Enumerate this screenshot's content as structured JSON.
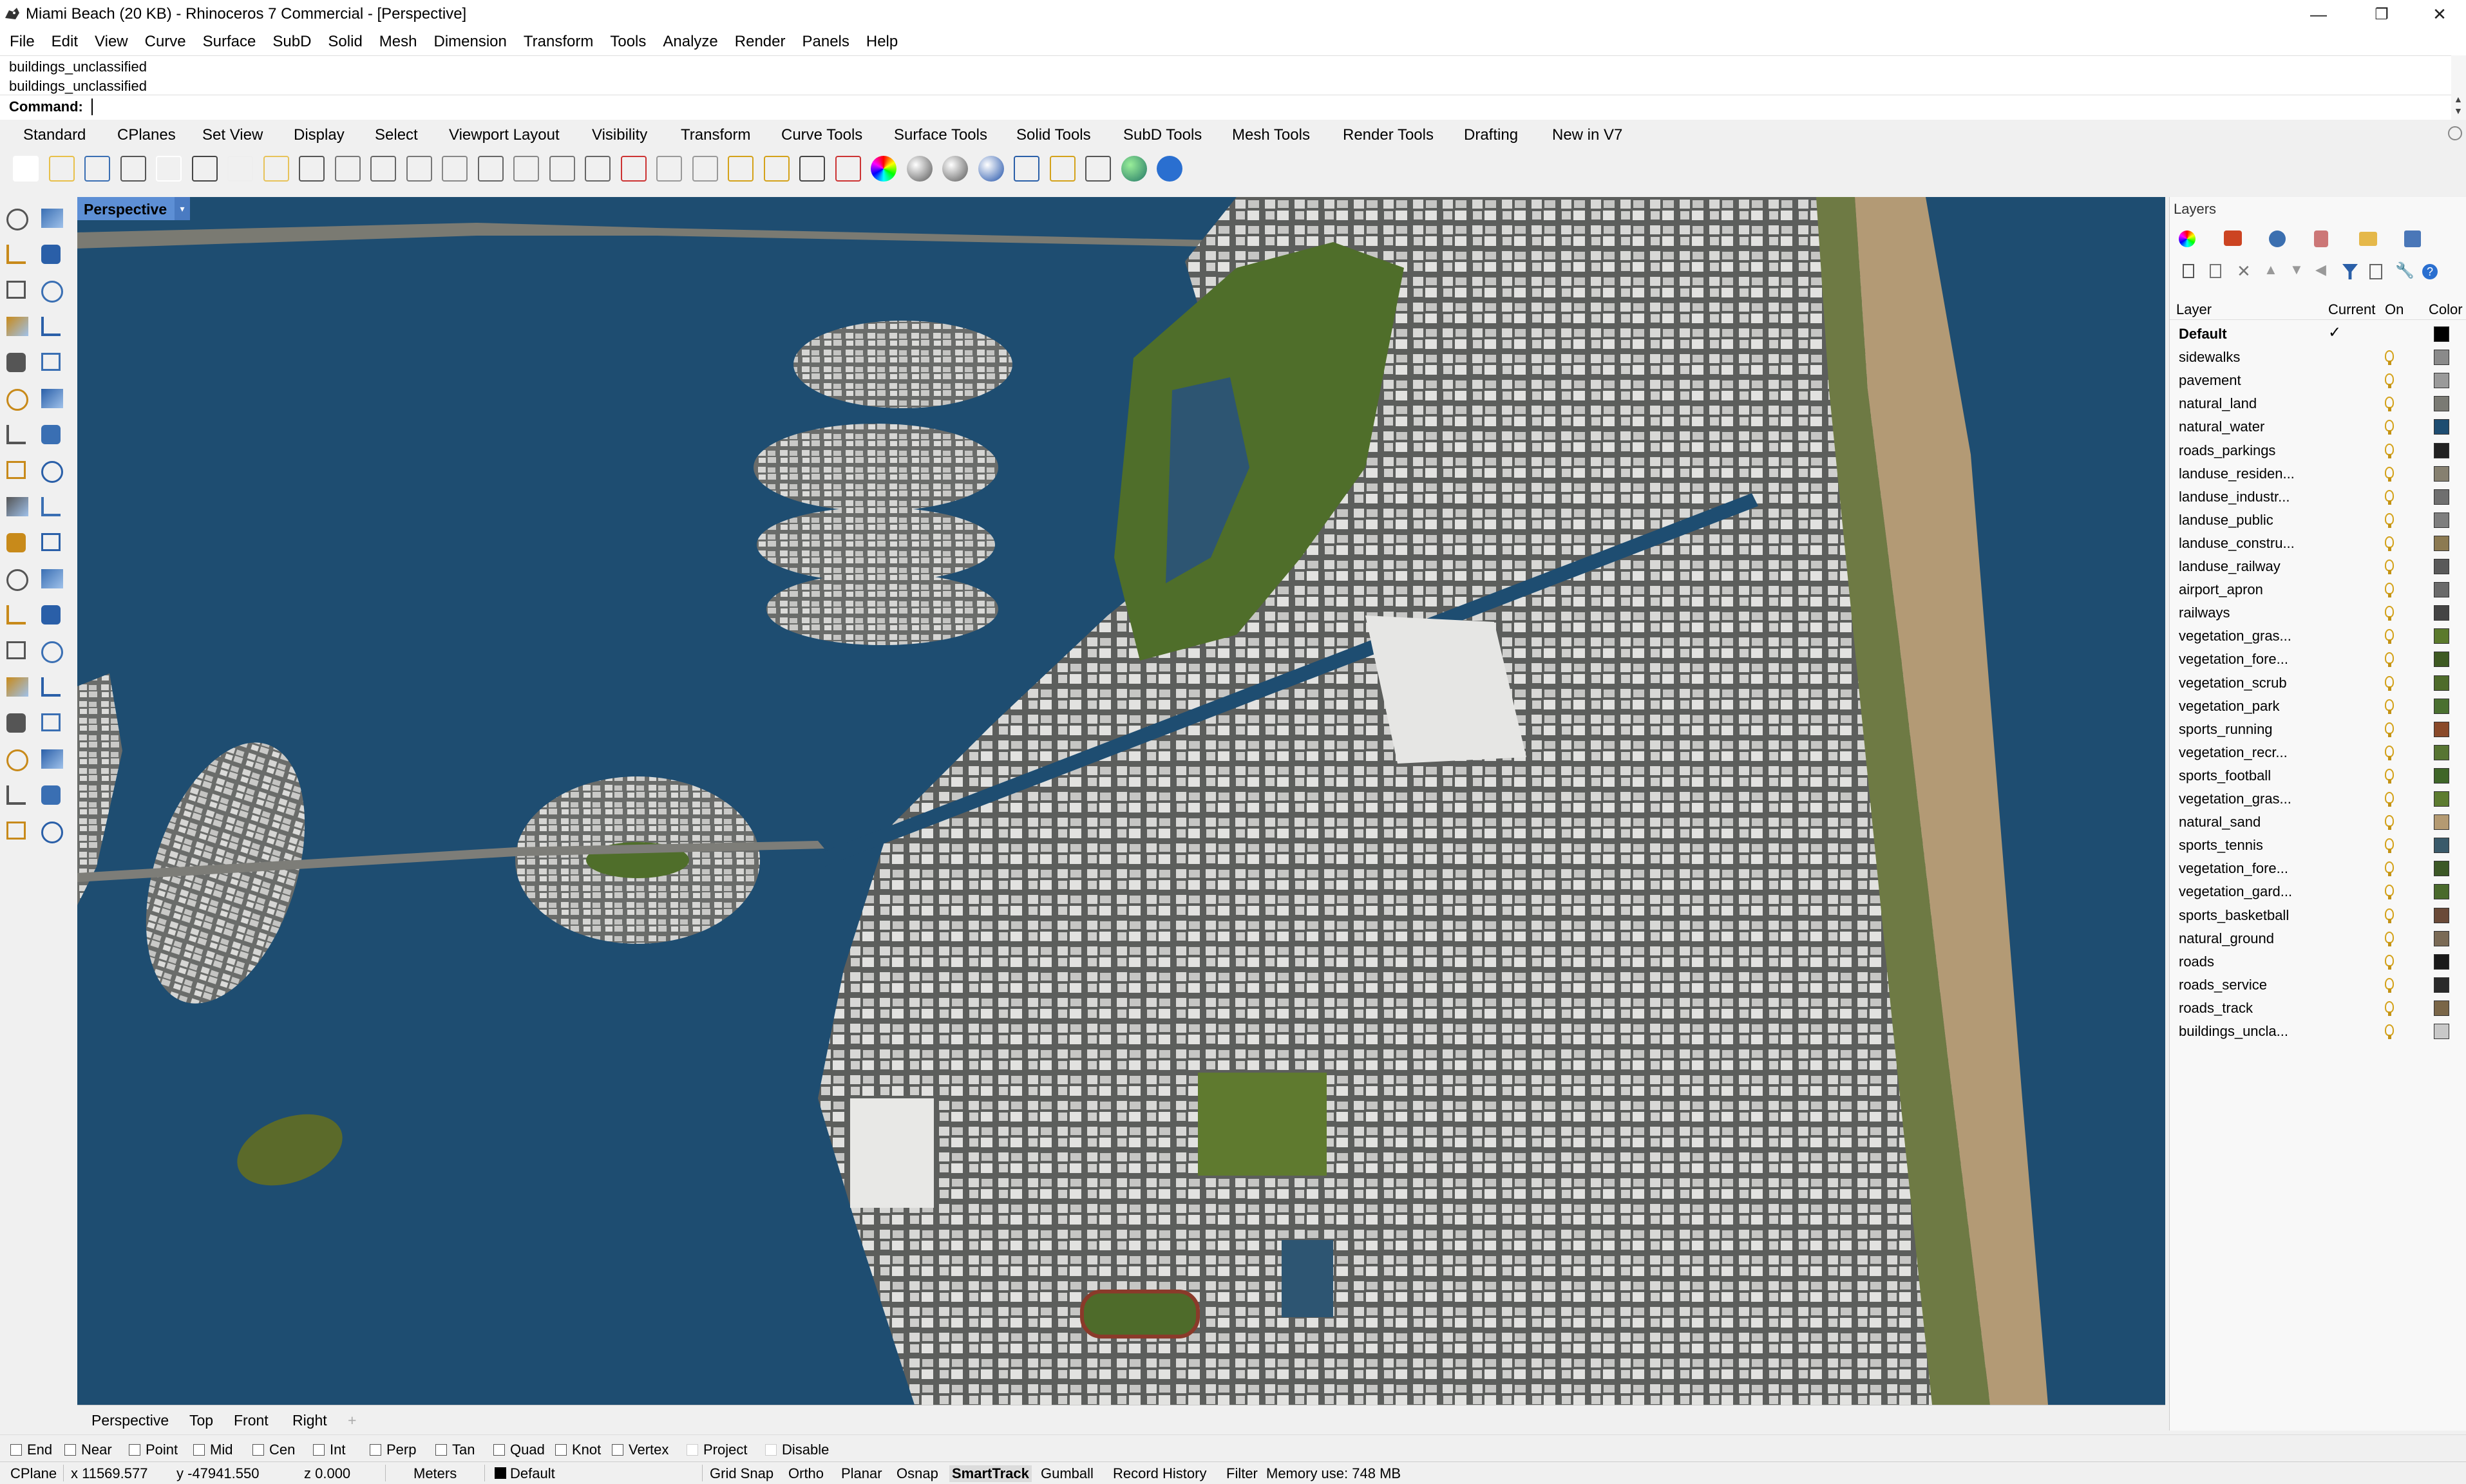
{
  "window": {
    "title": "Miami Beach (20 KB) - Rhinoceros 7 Commercial - [Perspective]",
    "min_glyph": "—",
    "max_glyph": "❐",
    "close_glyph": "✕"
  },
  "menu": [
    "File",
    "Edit",
    "View",
    "Curve",
    "Surface",
    "SubD",
    "Solid",
    "Mesh",
    "Dimension",
    "Transform",
    "Tools",
    "Analyze",
    "Render",
    "Panels",
    "Help"
  ],
  "command": {
    "history": [
      "buildings_unclassified",
      "buildings_unclassified"
    ],
    "prompt": "Command:",
    "value": ""
  },
  "tabs": [
    "Standard",
    "CPlanes",
    "Set View",
    "Display",
    "Select",
    "Viewport Layout",
    "Visibility",
    "Transform",
    "Curve Tools",
    "Surface Tools",
    "Solid Tools",
    "SubD Tools",
    "Mesh Tools",
    "Render Tools",
    "Drafting",
    "New in V7"
  ],
  "toolbar_icons": [
    "new-icon",
    "open-icon",
    "save-icon",
    "print-icon",
    "import-icon",
    "cut-icon",
    "copy-icon",
    "paste-icon",
    "undo-icon",
    "pan-icon",
    "rotate-view-icon",
    "zoom-icon",
    "zoom-window-icon",
    "zoom-extents-icon",
    "zoom-selected-icon",
    "zoom-all-icon",
    "four-views-icon",
    "car-icon",
    "grid-icon",
    "dimension-icon",
    "snap-icon",
    "light-icon",
    "lock-icon",
    "layer-icon",
    "color-wheel-icon",
    "shaded-sphere-icon",
    "render-sphere-icon",
    "rendered-icon",
    "spotlight-icon",
    "options-gear-icon",
    "scale-icon",
    "globe-icon",
    "help-icon"
  ],
  "left_tools": [
    "select-icon",
    "point-icon",
    "polyline-icon",
    "curve-icon",
    "circle-icon",
    "ellipse-icon",
    "arc-icon",
    "rectangle-icon",
    "polygon-icon",
    "free-curve-icon",
    "surface-icon",
    "extrude-surface-icon",
    "box-icon",
    "sphere-icon",
    "cylinder-icon",
    "mesh-icon",
    "loft-icon",
    "flame-icon",
    "trim-icon",
    "split-icon",
    "boolean-icon",
    "fillet-icon",
    "fillet-edge-icon",
    "blend-icon",
    "text-icon",
    "scale-icon",
    "array-icon",
    "move-icon",
    "solid-icon",
    "shelf-icon",
    "grid-array-icon",
    "gumball-icon",
    "edit-icon",
    "check-icon",
    "render-preview-icon",
    "paint-icon"
  ],
  "viewport": {
    "label": "Perspective",
    "dropdown_glyph": "▾"
  },
  "viewport_tabs": [
    "Perspective",
    "Top",
    "Front",
    "Right",
    "+"
  ],
  "panel": {
    "title": "Layers",
    "columns": {
      "layer": "Layer",
      "current": "Current",
      "on": "On",
      "color": "Color"
    },
    "current_mark": "✓",
    "layers": [
      {
        "name": "Default",
        "color": "#000000"
      },
      {
        "name": "sidewalks",
        "color": "#8a8a8a"
      },
      {
        "name": "pavement",
        "color": "#9a9a9a"
      },
      {
        "name": "natural_land",
        "color": "#7a7a74"
      },
      {
        "name": "natural_water",
        "color": "#1e4d71"
      },
      {
        "name": "roads_parkings",
        "color": "#222222"
      },
      {
        "name": "landuse_residen...",
        "color": "#868070"
      },
      {
        "name": "landuse_industr...",
        "color": "#6f6f6f"
      },
      {
        "name": "landuse_public",
        "color": "#7e7e7e"
      },
      {
        "name": "landuse_constru...",
        "color": "#8c7a52"
      },
      {
        "name": "landuse_railway",
        "color": "#5a5a5a"
      },
      {
        "name": "airport_apron",
        "color": "#6a6a6a"
      },
      {
        "name": "railways",
        "color": "#444444"
      },
      {
        "name": "vegetation_gras...",
        "color": "#5b7a2c"
      },
      {
        "name": "vegetation_fore...",
        "color": "#3e5a22"
      },
      {
        "name": "vegetation_scrub",
        "color": "#4e6b2a"
      },
      {
        "name": "vegetation_park",
        "color": "#4a7030"
      },
      {
        "name": "sports_running",
        "color": "#8a4a2a"
      },
      {
        "name": "vegetation_recr...",
        "color": "#577532"
      },
      {
        "name": "sports_football",
        "color": "#3f6628"
      },
      {
        "name": "vegetation_gras...",
        "color": "#5d7c30"
      },
      {
        "name": "natural_sand",
        "color": "#b49a72"
      },
      {
        "name": "sports_tennis",
        "color": "#3a5a6a"
      },
      {
        "name": "vegetation_fore...",
        "color": "#3c5826"
      },
      {
        "name": "vegetation_gard...",
        "color": "#4a6a2c"
      },
      {
        "name": "sports_basketball",
        "color": "#6a4a38"
      },
      {
        "name": "natural_ground",
        "color": "#7a6a55"
      },
      {
        "name": "roads",
        "color": "#1a1a1a"
      },
      {
        "name": "roads_service",
        "color": "#2a2a2a"
      },
      {
        "name": "roads_track",
        "color": "#7a6648"
      },
      {
        "name": "buildings_uncla...",
        "color": "#c8c8c8"
      }
    ]
  },
  "osnaps": [
    "End",
    "Near",
    "Point",
    "Mid",
    "Cen",
    "Int",
    "Perp",
    "Tan",
    "Quad",
    "Knot",
    "Vertex",
    "Project",
    "Disable"
  ],
  "status": {
    "cplane": "CPlane",
    "x": "x 11569.577",
    "y": "y -47941.550",
    "z": "z 0.000",
    "units": "Meters",
    "layer": "Default",
    "toggles": [
      "Grid Snap",
      "Ortho",
      "Planar",
      "Osnap",
      "SmartTrack",
      "Gumball",
      "Record History",
      "Filter"
    ],
    "memory": "Memory use: 748 MB"
  }
}
